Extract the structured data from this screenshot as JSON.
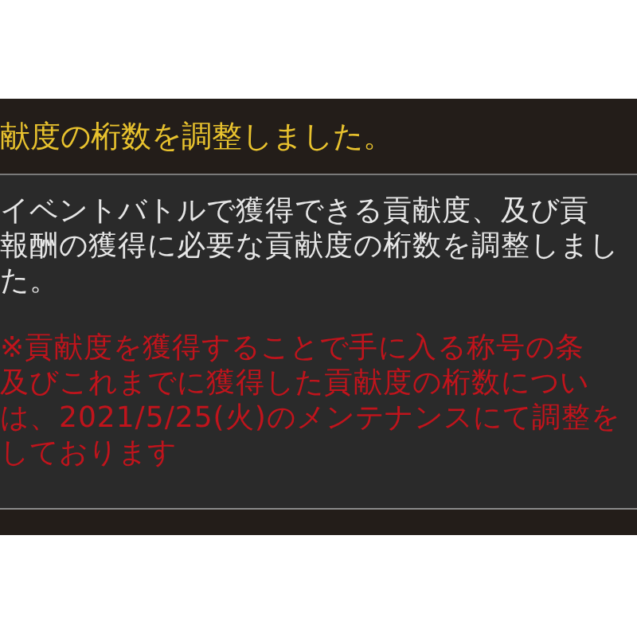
{
  "header": {
    "title": "献度の桁数を調整しました。"
  },
  "body": {
    "lines": [
      "イベントバトルで獲得できる貢献度、及び貢",
      "報酬の獲得に必要な貢献度の桁数を調整しまし",
      "た。"
    ],
    "note_lines": [
      "※貢献度を獲得することで手に入る称号の条",
      "及びこれまでに獲得した貢献度の桁数につい",
      "は、2021/5/25(火)のメンテナンスにて調整を",
      "しております"
    ]
  }
}
